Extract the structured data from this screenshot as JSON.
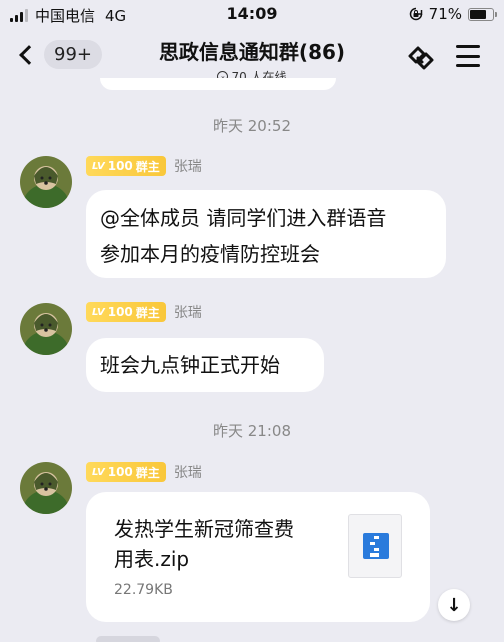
{
  "status_bar": {
    "carrier": "中国电信",
    "network": "4G",
    "time": "14:09",
    "battery": "71%",
    "battery_level": 0.71,
    "rotation_lock_icon": "rotation-lock-icon"
  },
  "nav": {
    "unread_count": "99+",
    "title": "思政信息通知群(86)",
    "online": "70 人在线",
    "icons": {
      "back": "chevron-left-icon",
      "share": "share-link-icon",
      "menu": "menu-icon"
    }
  },
  "messages": [
    {
      "timestamp": "昨天 20:52",
      "level": "LV",
      "level_num": "100",
      "role": "群主",
      "sender": "张瑞",
      "text_lines": [
        "@全体成员  请同学们进入群语音",
        "参加本月的疫情防控班会"
      ]
    },
    {
      "level": "LV",
      "level_num": "100",
      "role": "群主",
      "sender": "张瑞",
      "text_lines": [
        "班会九点钟正式开始"
      ]
    },
    {
      "timestamp": "昨天 21:08",
      "level": "LV",
      "level_num": "100",
      "role": "群主",
      "sender": "张瑞",
      "file": {
        "name_lines": [
          "发热学生新冠筛查费",
          "用表.zip"
        ],
        "size": "22.79KB",
        "icon": "zip-file-icon"
      }
    }
  ],
  "scroll_down_icon": "↓",
  "colors": {
    "background": "#ebebf2",
    "bubble": "#ffffff",
    "badge": "#f9c73a",
    "zip": "#2a7bdc"
  }
}
